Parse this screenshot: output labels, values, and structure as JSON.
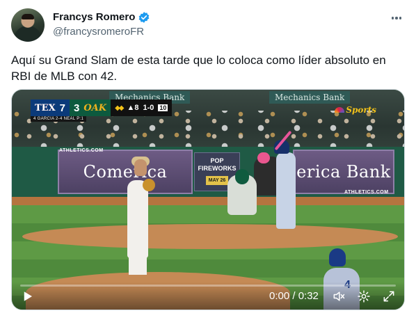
{
  "author": {
    "display_name": "Francys Romero",
    "handle": "@francysromeroFR",
    "verified": true
  },
  "tweet": {
    "text": "Aquí su Grand Slam de esta tarde que lo coloca como líder absoluto en\nRBI de MLB con 42."
  },
  "video": {
    "scorebug": {
      "away_team": "TEX",
      "away_score": "7",
      "home_team": "OAK",
      "home_score": "3",
      "inning": "▲8",
      "count": "1-0",
      "outs_label": "10",
      "subline": "4 GARCIA   2-4  NEAL   P:1"
    },
    "broadcast": "Sports",
    "ads": {
      "left_sign": "Mechanics Bank",
      "right_sign": "Mechanics Bank",
      "left_panel": "Comerica Bank",
      "right_panel": "erica Bank",
      "center_ad_title": "POP FIREWORKS",
      "center_ad_date": "MAY 26",
      "athletics_left": "ATHLETICS.COM",
      "athletics_right": "ATHLETICS.COM"
    },
    "player_number": "4",
    "time_display": "0:00 / 0:32",
    "progress": 0.0
  },
  "icons": {
    "more": "more-icon",
    "play": "play-icon",
    "volume": "volume-icon",
    "settings": "settings-icon",
    "fullscreen": "fullscreen-icon",
    "verified": "verified-badge-icon"
  },
  "colors": {
    "text": "#0f1419",
    "secondary": "#536471",
    "verified": "#1d9bf0"
  }
}
